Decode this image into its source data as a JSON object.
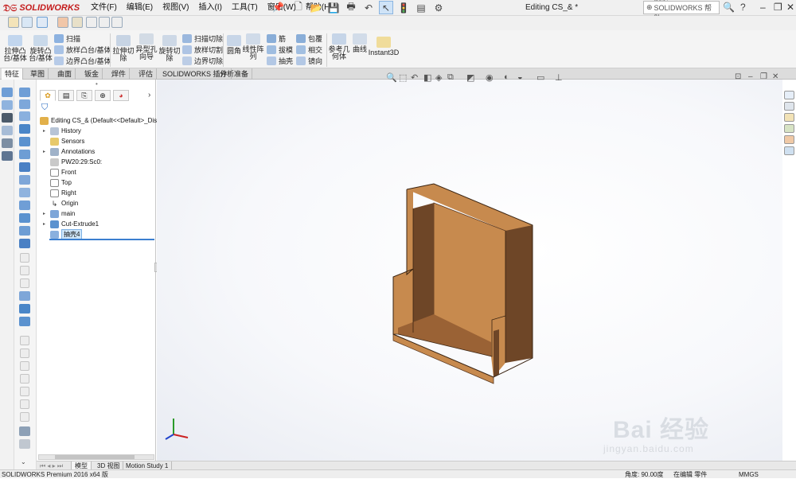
{
  "app": {
    "logo_text": "SOLIDWORKS",
    "doc_title": "Editing CS_& *",
    "search_placeholder": "搜索 SOLIDWORKS 帮助",
    "menu": [
      "文件(F)",
      "编辑(E)",
      "视图(V)",
      "插入(I)",
      "工具(T)",
      "窗口(W)",
      "帮助(H)"
    ]
  },
  "ribbon": {
    "extrude_boss": "拉伸凸\n台/基体",
    "revolve_boss": "旋转凸\n台/基体",
    "sweep": "扫描",
    "loft": "放样凸台/基体",
    "boundary": "边界凸台/基体",
    "extruded_cut": "拉伸切\n除",
    "hole_wizard": "异型孔\n向导",
    "revolved_cut": "旋转切\n除",
    "swept_cut": "扫描切除",
    "lofted_cut": "放样切割",
    "boundary_cut": "边界切除",
    "fillet": "圆角",
    "linear_pattern": "线性阵\n列",
    "rib": "筋",
    "draft": "拔模",
    "shell": "抽壳",
    "wrap": "包覆",
    "intersect": "相交",
    "mirror": "镜向",
    "ref_geometry": "参考几\n何体",
    "curves": "曲线",
    "instant3d": "Instant3D"
  },
  "tabs": [
    "特征",
    "草图",
    "曲面",
    "钣金",
    "焊件",
    "评估",
    "SOLIDWORKS 插件",
    "分析准备"
  ],
  "active_tab": "特征",
  "tree": {
    "root": "Editing CS_&  (Default<<Default>_Dis",
    "items": [
      "History",
      "Sensors",
      "Annotations",
      "PW20:29:Sc0:",
      "Front",
      "Top",
      "Right",
      "Origin",
      "main",
      "Cut-Extrude1",
      "抽壳4"
    ]
  },
  "bottom_tabs": [
    "模型",
    "3D 视图",
    "Motion Study 1"
  ],
  "status": {
    "left": "SOLIDWORKS Premium 2016 x64 版",
    "angle": "角度: 90.00度",
    "mode": "在编辑 零件",
    "units": "MMGS"
  },
  "watermark": {
    "line1": "Bai 经验",
    "line2": "jingyan.baidu.com"
  },
  "colors": {
    "part_face": "#c78a4e",
    "part_dark": "#6e4627",
    "part_mid": "#9a6235",
    "accent": "#3b7fd0"
  }
}
